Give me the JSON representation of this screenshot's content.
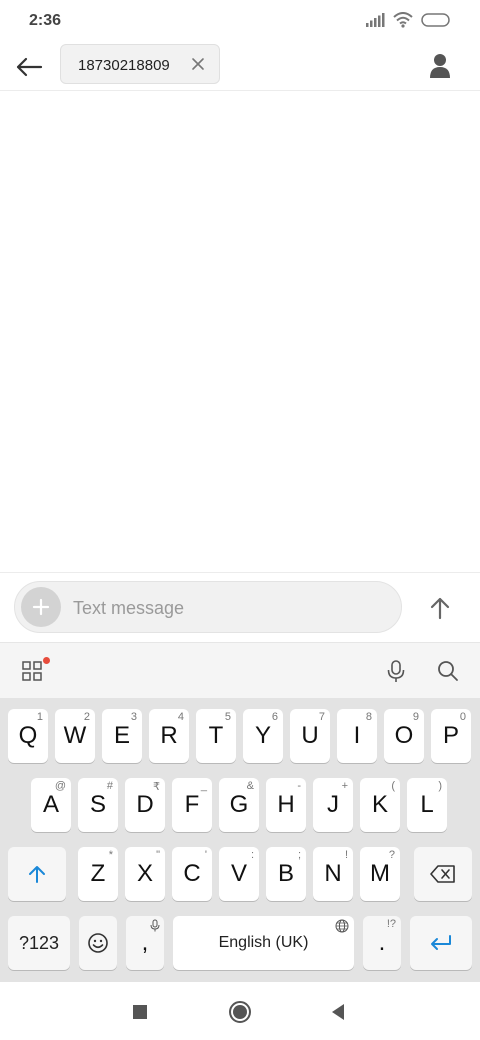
{
  "status_bar": {
    "time": "2:36"
  },
  "header": {
    "recipient": "18730218809"
  },
  "compose": {
    "placeholder": "Text message",
    "value": ""
  },
  "keyboard": {
    "row1": [
      {
        "key": "Q",
        "hint": "1"
      },
      {
        "key": "W",
        "hint": "2"
      },
      {
        "key": "E",
        "hint": "3"
      },
      {
        "key": "R",
        "hint": "4"
      },
      {
        "key": "T",
        "hint": "5"
      },
      {
        "key": "Y",
        "hint": "6"
      },
      {
        "key": "U",
        "hint": "7"
      },
      {
        "key": "I",
        "hint": "8"
      },
      {
        "key": "O",
        "hint": "9"
      },
      {
        "key": "P",
        "hint": "0"
      }
    ],
    "row2": [
      {
        "key": "A",
        "hint": "@"
      },
      {
        "key": "S",
        "hint": "#"
      },
      {
        "key": "D",
        "hint": "₹"
      },
      {
        "key": "F",
        "hint": "_"
      },
      {
        "key": "G",
        "hint": "&"
      },
      {
        "key": "H",
        "hint": "-"
      },
      {
        "key": "J",
        "hint": "+"
      },
      {
        "key": "K",
        "hint": "("
      },
      {
        "key": "L",
        "hint": ")"
      }
    ],
    "row3": [
      {
        "key": "Z",
        "hint": "*"
      },
      {
        "key": "X",
        "hint": "\""
      },
      {
        "key": "C",
        "hint": "'"
      },
      {
        "key": "V",
        "hint": ":"
      },
      {
        "key": "B",
        "hint": ";"
      },
      {
        "key": "N",
        "hint": "!"
      },
      {
        "key": "M",
        "hint": "?"
      }
    ],
    "row4": {
      "symbols_label": "?123",
      "comma": ",",
      "space_label": "English (UK)",
      "period": ".",
      "period_hint": "!?"
    }
  },
  "colors": {
    "accent": "#1a88d8",
    "notification_dot": "#e74c3c",
    "keyboard_bg": "#e3e3e3"
  },
  "icons": {
    "back": "arrow-left-icon",
    "chip_close": "close-icon",
    "contact": "person-icon",
    "attach": "plus-icon",
    "send": "arrow-up-icon",
    "apps": "grid-icon",
    "mic": "microphone-icon",
    "search": "search-icon",
    "shift": "shift-arrow-icon",
    "backspace": "backspace-icon",
    "emoji": "emoji-icon",
    "globe": "globe-icon",
    "enter": "enter-icon",
    "nav_recents": "square-icon",
    "nav_home": "circle-icon",
    "nav_back": "triangle-back-icon"
  }
}
